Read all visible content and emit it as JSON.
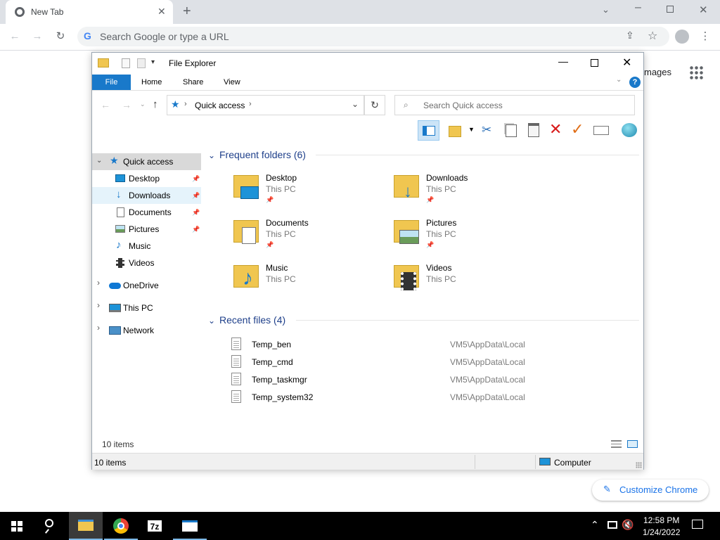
{
  "browser": {
    "tab_title": "New Tab",
    "omnibox_placeholder": "Search Google or type a URL",
    "images_link": "mages",
    "customize_label": "Customize Chrome"
  },
  "explorer": {
    "title": "File Explorer",
    "ribbon_tabs": [
      "File",
      "Home",
      "Share",
      "View"
    ],
    "address": "Quick access",
    "search_placeholder": "Search Quick access",
    "nav": {
      "quick_access": "Quick access",
      "pinned": [
        "Desktop",
        "Downloads",
        "Documents",
        "Pictures"
      ],
      "others": [
        "Music",
        "Videos"
      ],
      "onedrive": "OneDrive",
      "this_pc": "This PC",
      "network": "Network"
    },
    "frequent_header": "Frequent folders (6)",
    "folders": [
      {
        "name": "Desktop",
        "loc": "This PC",
        "pinned": true
      },
      {
        "name": "Downloads",
        "loc": "This PC",
        "pinned": true
      },
      {
        "name": "Documents",
        "loc": "This PC",
        "pinned": true
      },
      {
        "name": "Pictures",
        "loc": "This PC",
        "pinned": true
      },
      {
        "name": "Music",
        "loc": "This PC",
        "pinned": false
      },
      {
        "name": "Videos",
        "loc": "This PC",
        "pinned": false
      }
    ],
    "recent_header": "Recent files (4)",
    "recent": [
      {
        "name": "Temp_ben",
        "path": "VM5\\AppData\\Local"
      },
      {
        "name": "Temp_cmd",
        "path": "VM5\\AppData\\Local"
      },
      {
        "name": "Temp_taskmgr",
        "path": "VM5\\AppData\\Local"
      },
      {
        "name": "Temp_system32",
        "path": "VM5\\AppData\\Local"
      }
    ],
    "status_count": "10 items",
    "status_count2": "10 items",
    "status_computer": "Computer"
  },
  "taskbar": {
    "time": "12:58 PM",
    "date": "1/24/2022",
    "sevenzip": "7z"
  },
  "colors": {
    "accent": "#1979ca",
    "chrome_bg": "#dee1e6",
    "folder": "#f0c650"
  }
}
